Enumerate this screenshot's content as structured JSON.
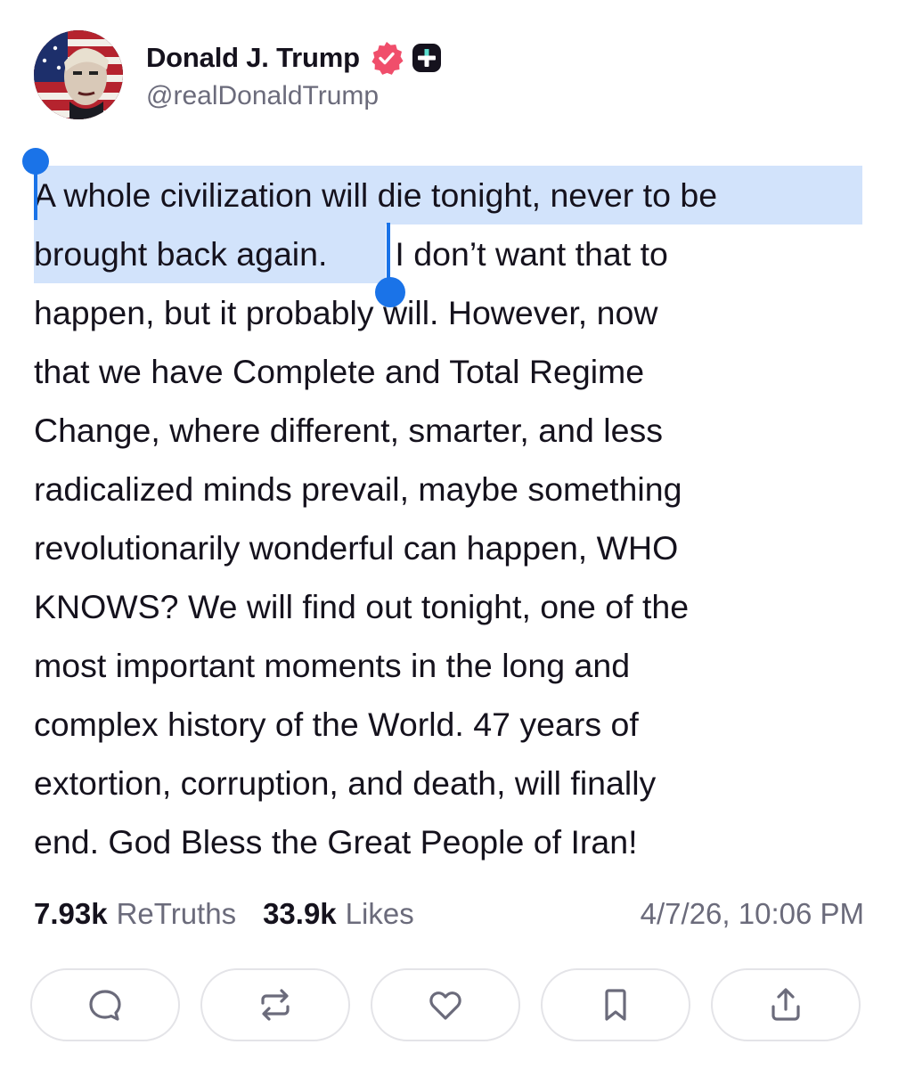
{
  "author": {
    "display_name": "Donald J. Trump",
    "handle": "@realDonaldTrump",
    "verified_badge_color": "#f04e6b"
  },
  "post": {
    "selected_text_line1": "A whole civilization will die tonight, never to be",
    "selected_text_line2": "brought back again.",
    "line2_rest": " I don’t want that to",
    "lines": [
      "happen, but it probably will. However, now",
      "that we have Complete and Total Regime",
      "Change, where different, smarter, and less",
      "radicalized minds prevail, maybe something",
      "revolutionarily wonderful can happen, WHO",
      "KNOWS? We will find out tonight, one of the",
      "most important moments in the long and",
      "complex history of the World. 47 years of",
      "extortion, corruption, and death, will finally",
      "end. God Bless the Great People of Iran!"
    ],
    "selection_color": "#d2e3fb",
    "selection_handle_color": "#1a73e8"
  },
  "stats": {
    "retruths_count": "7.93k",
    "retruths_label": "ReTruths",
    "likes_count": "33.9k",
    "likes_label": "Likes",
    "timestamp": "4/7/26, 10:06 PM"
  },
  "actions": [
    {
      "icon": "reply-icon"
    },
    {
      "icon": "retruth-icon"
    },
    {
      "icon": "like-icon"
    },
    {
      "icon": "bookmark-icon"
    },
    {
      "icon": "share-icon"
    }
  ]
}
